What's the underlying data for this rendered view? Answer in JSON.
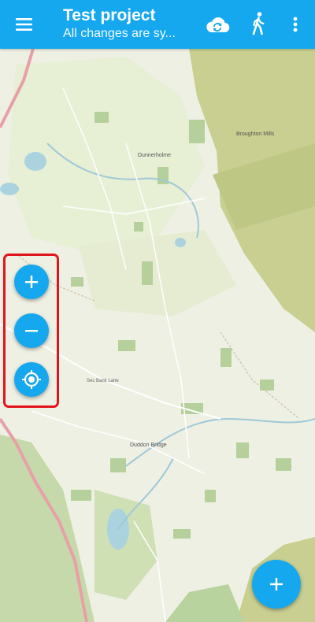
{
  "app": {
    "title": "Test project",
    "subtitle": "All changes are sy..."
  },
  "toolbar": {
    "icons": [
      "hamburger-menu-icon",
      "cloud-sync-icon",
      "walking-person-icon",
      "overflow-menu-icon"
    ]
  },
  "map_controls": {
    "icons": [
      "plus-icon",
      "minus-icon",
      "crosshair-icon"
    ]
  },
  "fab": {
    "icon": "plus-icon"
  },
  "map": {
    "place_labels": [
      "Dunnerholme",
      "Duddon Bridge",
      "Broughton Mills",
      "Sec Bank Lane"
    ]
  },
  "colors": {
    "accent": "#16a8ee",
    "highlight_border": "#e2141c",
    "map_background": "#eef0e4",
    "woodland": "#b5d09a",
    "moorland": "#c7cf8c",
    "water": "#aad3df"
  }
}
